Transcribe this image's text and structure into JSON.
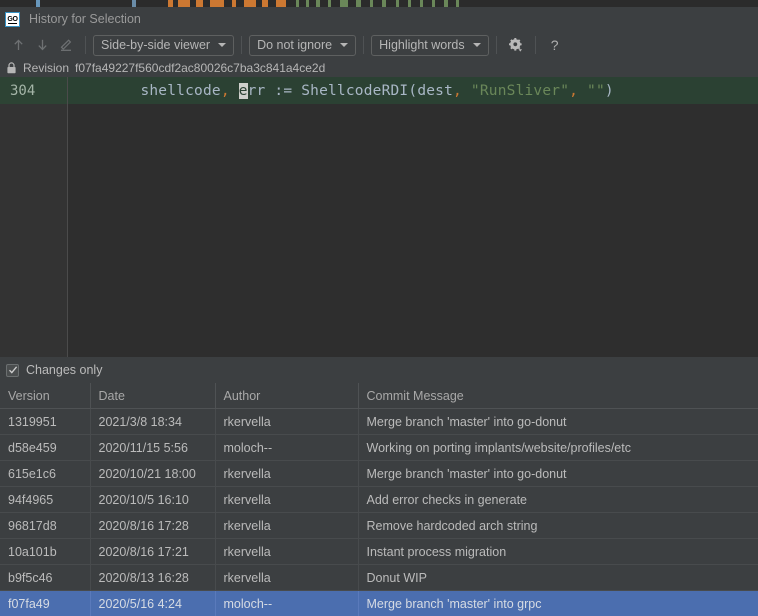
{
  "window": {
    "icon": "go-file-icon",
    "title": "History for Selection"
  },
  "toolbar": {
    "prev_icon": "arrow-up-icon",
    "next_icon": "arrow-down-icon",
    "edit_icon": "pencil-icon",
    "viewer_mode": "Side-by-side viewer",
    "ignore_mode": "Do not ignore",
    "highlight_mode": "Highlight words",
    "settings_icon": "gear-icon",
    "help_icon": "question-mark-icon"
  },
  "revision": {
    "lock_icon": "lock-icon",
    "label": "Revision",
    "hash": "f07fa49227f560cdf2ac80026c7ba3c841a4ce2d"
  },
  "diff": {
    "line_number": "304",
    "code_tokens": [
      {
        "t": "        shellcode",
        "c": "ident"
      },
      {
        "t": ",",
        "c": "punct"
      },
      {
        "t": " ",
        "c": "plain"
      },
      {
        "t": "e",
        "c": "caret"
      },
      {
        "t": "rr := ShellcodeRDI",
        "c": "ident"
      },
      {
        "t": "(",
        "c": "plain"
      },
      {
        "t": "dest",
        "c": "ident"
      },
      {
        "t": ",",
        "c": "punct"
      },
      {
        "t": " ",
        "c": "plain"
      },
      {
        "t": "\"RunSliver\"",
        "c": "str"
      },
      {
        "t": ",",
        "c": "punct"
      },
      {
        "t": " ",
        "c": "plain"
      },
      {
        "t": "\"\"",
        "c": "str"
      },
      {
        "t": ")",
        "c": "plain"
      }
    ],
    "code_plain": "        shellcode, err := ShellcodeRDI(dest, \"RunSliver\", \"\")"
  },
  "filter": {
    "changes_only_label": "Changes only",
    "changes_only_checked": true,
    "check_icon": "checkmark-icon"
  },
  "table": {
    "columns": [
      "Version",
      "Date",
      "Author",
      "Commit Message"
    ],
    "rows": [
      {
        "version": "1319951",
        "date": "2021/3/8 18:34",
        "author": "rkervella",
        "message": "Merge branch 'master' into go-donut",
        "selected": false
      },
      {
        "version": "d58e459",
        "date": "2020/11/15 5:56",
        "author": "moloch--",
        "message": "Working on porting implants/website/profiles/etc",
        "selected": false
      },
      {
        "version": "615e1c6",
        "date": "2020/10/21 18:00",
        "author": "rkervella",
        "message": "Merge branch 'master' into go-donut",
        "selected": false
      },
      {
        "version": "94f4965",
        "date": "2020/10/5 16:10",
        "author": "rkervella",
        "message": "Add error checks in generate",
        "selected": false
      },
      {
        "version": "96817d8",
        "date": "2020/8/16 17:28",
        "author": "rkervella",
        "message": "Remove hardcoded arch string",
        "selected": false
      },
      {
        "version": "10a101b",
        "date": "2020/8/16 17:21",
        "author": "rkervella",
        "message": "Instant process migration",
        "selected": false
      },
      {
        "version": "b9f5c46",
        "date": "2020/8/13 16:28",
        "author": "rkervella",
        "message": "Donut WIP",
        "selected": false
      },
      {
        "version": "f07fa49",
        "date": "2020/5/16 4:24",
        "author": "moloch--",
        "message": "Merge branch 'master' into grpc",
        "selected": true
      }
    ]
  },
  "colors": {
    "panel_bg": "#3c3f41",
    "editor_bg": "#2e2e2e",
    "added_line_bg": "#2b4133",
    "selection_blue": "#4b6eaf",
    "accent_blue": "#3592c4",
    "string_green": "#6a8759",
    "punct_orange": "#cc7832",
    "ident_grey": "#a9b7c6"
  }
}
